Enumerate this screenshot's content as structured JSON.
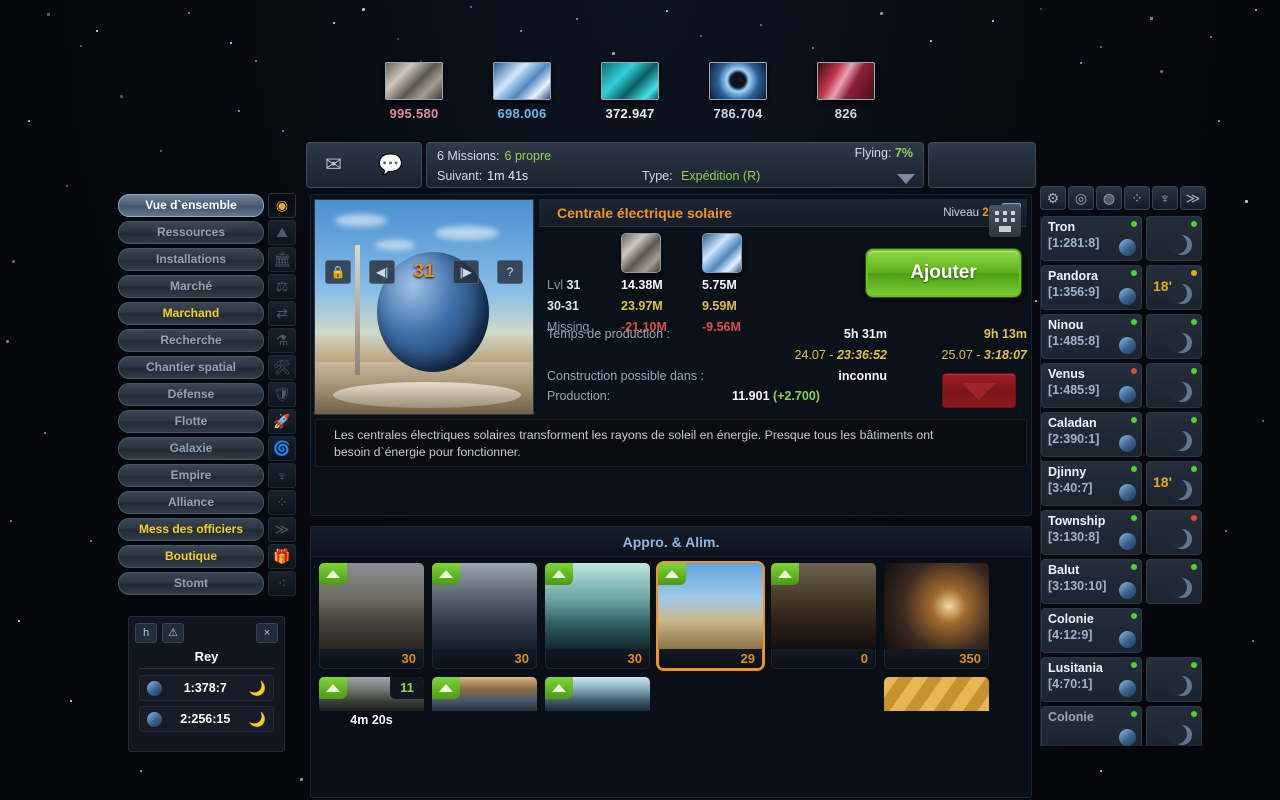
{
  "resources": [
    {
      "name": "metal",
      "value": "995.580",
      "color": "#e5889f"
    },
    {
      "name": "crystal",
      "value": "698.006",
      "color": "#6fb7e8"
    },
    {
      "name": "deuterium",
      "value": "372.947",
      "color": "#e9f1f7"
    },
    {
      "name": "darkmatter",
      "value": "786.704",
      "color": "#cfd9e4"
    },
    {
      "name": "energy",
      "value": "826",
      "color": "#cfd9e4"
    }
  ],
  "topbar": {
    "mail_icon": "envelope-icon",
    "chat_icon": "chat-bubble-icon",
    "missions_label": "6 Missions:",
    "missions_value": "6 propre",
    "next_label": "Suivant:",
    "next_value": "1m 41s",
    "type_label": "Type:",
    "type_value": "Expédition (R)",
    "flying_label": "Flying:",
    "flying_value": "7%"
  },
  "detail": {
    "title": "Centrale électrique solaire",
    "level_label": "Niveau",
    "level_value": "29",
    "close_icon": "close-icon",
    "preview": {
      "lock_icon": "lock-icon",
      "prev_icon": "previous-icon",
      "level": "31",
      "next_icon": "next-icon",
      "help_icon": "help-icon"
    },
    "cost_rows": [
      {
        "label_prefix": "Lvl",
        "label_bold": "31",
        "metal": "14.38M",
        "crystal": "5.75M",
        "style": "white"
      },
      {
        "label_prefix": "",
        "label_bold": "30-31",
        "metal": "23.97M",
        "crystal": "9.59M",
        "style": "gold"
      },
      {
        "label_prefix": "Missing",
        "label_bold": "",
        "metal": "-21.10M",
        "crystal": "-9.56M",
        "style": "red"
      }
    ],
    "add_button": "Ajouter",
    "prod_time_label": "Temps de production :",
    "prod_time_a": "5h 31m",
    "prod_date_a": "24.07 -",
    "prod_clock_a": "23:36:52",
    "prod_time_b": "9h 13m",
    "prod_date_b": "25.07 -",
    "prod_clock_b": "3:18:07",
    "build_possible_label": "Construction possible dans :",
    "build_possible_value": "inconnu",
    "production_label": "Production:",
    "production_value": "11.901",
    "production_delta": "(+2.700)",
    "demolish_icon": "demolish-down-arrow-icon",
    "description": "Les centrales électriques solaires transforment les rayons de soleil en énergie. Presque tous les bâtiments ont besoin d`énergie pour fonctionner.",
    "description_icon": "keypad-icon"
  },
  "buildings": {
    "header": "Appro. & Alim.",
    "row1": [
      {
        "name": "mine-metal",
        "count": "30",
        "art": "a1",
        "upgrade": true,
        "selected": false
      },
      {
        "name": "mine-crystal",
        "count": "30",
        "art": "a2",
        "upgrade": true,
        "selected": false
      },
      {
        "name": "deuterium-sync",
        "count": "30",
        "art": "a3",
        "upgrade": true,
        "selected": false
      },
      {
        "name": "solar-plant",
        "count": "29",
        "art": "a4",
        "upgrade": true,
        "selected": true
      },
      {
        "name": "fusion-reactor",
        "count": "0",
        "art": "a5",
        "upgrade": true,
        "selected": false
      },
      {
        "name": "solar-satellite",
        "count": "350",
        "art": "a6",
        "upgrade": false,
        "selected": false
      }
    ],
    "row2": [
      {
        "name": "metal-storage",
        "count": "11",
        "art": "a7",
        "upgrade": true,
        "timer": "4m 20s"
      },
      {
        "name": "crystal-storage",
        "count": "",
        "art": "a8",
        "upgrade": true,
        "timer": ""
      },
      {
        "name": "deuterium-tank",
        "count": "",
        "art": "a9",
        "upgrade": true,
        "timer": ""
      },
      {
        "name": "empty-slot-1",
        "count": "",
        "art": "",
        "upgrade": false,
        "timer": ""
      },
      {
        "name": "empty-slot-2",
        "count": "",
        "art": "",
        "upgrade": false,
        "timer": ""
      },
      {
        "name": "locked-slot",
        "count": "",
        "art": "a10",
        "upgrade": false,
        "timer": ""
      }
    ]
  },
  "sidebar": {
    "items": [
      {
        "label": "Vue d`ensemble",
        "state": "active",
        "icon": "overview-icon"
      },
      {
        "label": "Ressources",
        "state": "normal",
        "icon": "resources-icon"
      },
      {
        "label": "Installations",
        "state": "normal",
        "icon": "facilities-icon"
      },
      {
        "label": "Marché",
        "state": "normal",
        "icon": "market-scales-icon"
      },
      {
        "label": "Marchand",
        "state": "high",
        "icon": "trader-arrows-icon"
      },
      {
        "label": "Recherche",
        "state": "normal",
        "icon": "research-icon"
      },
      {
        "label": "Chantier spatial",
        "state": "normal",
        "icon": "shipyard-icon"
      },
      {
        "label": "Défense",
        "state": "normal",
        "icon": "defense-icon"
      },
      {
        "label": "Flotte",
        "state": "normal",
        "icon": "fleet-icon"
      },
      {
        "label": "Galaxie",
        "state": "normal",
        "icon": "galaxy-icon"
      },
      {
        "label": "Empire",
        "state": "normal",
        "icon": "empire-icon"
      },
      {
        "label": "Alliance",
        "state": "normal",
        "icon": "alliance-icon"
      },
      {
        "label": "Mess des officiers",
        "state": "high",
        "icon": "officers-icon"
      },
      {
        "label": "Boutique",
        "state": "high",
        "icon": "shop-icon"
      },
      {
        "label": "Stomt",
        "state": "normal",
        "icon": "stomt-icon"
      }
    ]
  },
  "rey": {
    "btn_h": "h",
    "btn_warn": "⚠",
    "close": "×",
    "title": "Rey",
    "rows": [
      {
        "coord": "1:378:7"
      },
      {
        "coord": "2:256:15"
      }
    ]
  },
  "right_panel": {
    "icons": [
      "gear-icon",
      "target-icon",
      "planet-icon",
      "alliance-network-icon",
      "empire-icon",
      "chevrons-icon"
    ],
    "planets": [
      {
        "name": "Tron",
        "coord": "[1:281:8]",
        "status": "g",
        "moon": true,
        "moon_status": "g",
        "moon_time": ""
      },
      {
        "name": "Pandora",
        "coord": "[1:356:9]",
        "status": "g",
        "moon": true,
        "moon_status": "o",
        "moon_time": "18'"
      },
      {
        "name": "Ninou",
        "coord": "[1:485:8]",
        "status": "g",
        "moon": true,
        "moon_status": "g",
        "moon_time": ""
      },
      {
        "name": "Venus",
        "coord": "[1:485:9]",
        "status": "r",
        "moon": true,
        "moon_status": "g",
        "moon_time": ""
      },
      {
        "name": "Caladan",
        "coord": "[2:390:1]",
        "status": "g",
        "moon": true,
        "moon_status": "g",
        "moon_time": ""
      },
      {
        "name": "Djinny",
        "coord": "[3:40:7]",
        "status": "g",
        "moon": true,
        "moon_status": "g",
        "moon_time": "18'"
      },
      {
        "name": "Township",
        "coord": "[3:130:8]",
        "status": "g",
        "moon": true,
        "moon_status": "r",
        "moon_time": ""
      },
      {
        "name": "Balut",
        "coord": "[3:130:10]",
        "status": "g",
        "moon": true,
        "moon_status": "g",
        "moon_time": ""
      },
      {
        "name": "Colonie",
        "coord": "[4:12:9]",
        "status": "g",
        "moon": false,
        "moon_status": "",
        "moon_time": ""
      },
      {
        "name": "Lusitania",
        "coord": "[4:70:1]",
        "status": "g",
        "moon": true,
        "moon_status": "g",
        "moon_time": ""
      },
      {
        "name": "Colonie",
        "coord": "",
        "status": "g",
        "moon": true,
        "moon_status": "g",
        "moon_time": ""
      }
    ]
  }
}
